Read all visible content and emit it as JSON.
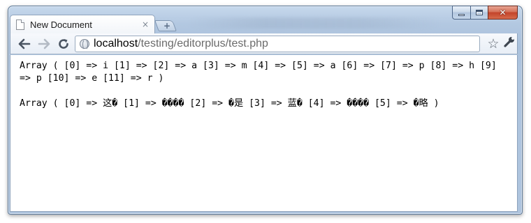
{
  "window": {
    "caption": {
      "minimize_icon": "minimize-icon",
      "maximize_icon": "maximize-icon",
      "close_glyph": "✕"
    }
  },
  "tab": {
    "title": "New Document",
    "close_glyph": "×",
    "icon": "document-icon"
  },
  "new_tab": {
    "glyph": "+"
  },
  "toolbar": {
    "back_glyph": "🡐",
    "forward_glyph": "🡒",
    "reload_glyph": "↻",
    "star_glyph": "☆",
    "wrench_glyph": "🔧"
  },
  "omnibox": {
    "host": "localhost",
    "path": "/testing/editorplus/test.php"
  },
  "page": {
    "line1": "Array ( [0] => i [1] => [2] => a [3] => m [4] => [5] => a [6] => [7] => p [8] => h [9] => p [10] => e [11] => r )",
    "line2": "Array ( [0] => 这� [1] => ���� [2] => �是 [3] => 蓝� [4] => ���� [5] => �略 )"
  },
  "colors": {
    "frame": "#b3c8e1",
    "close_button": "#c3432a",
    "content_bg": "#ffffff"
  }
}
